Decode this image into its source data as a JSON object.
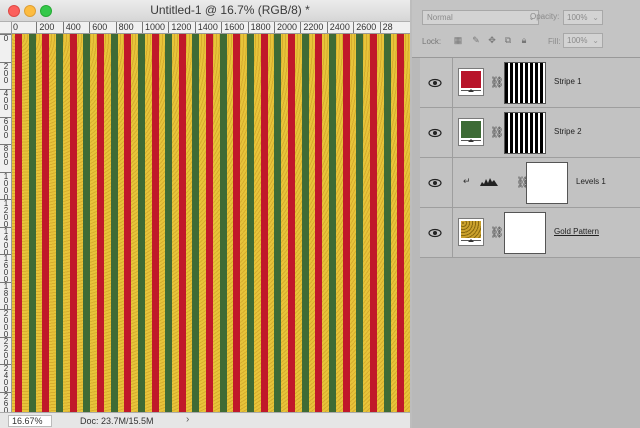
{
  "window": {
    "title": "Untitled-1 @ 16.7% (RGB/8) *"
  },
  "ruler": {
    "h_ticks": [
      "0",
      "200",
      "400",
      "600",
      "800",
      "1000",
      "1200",
      "1400",
      "1600",
      "1800",
      "2000",
      "2200",
      "2400",
      "2600",
      "28"
    ],
    "v_ticks": [
      "0",
      "2\n0\n0",
      "4\n0\n0",
      "6\n0\n0",
      "8\n0\n0",
      "1\n0\n0\n0",
      "1\n2\n0\n0",
      "1\n4\n0\n0",
      "1\n6\n0\n0",
      "1\n8\n0\n0",
      "2\n0\n0\n0",
      "2\n2\n0\n0",
      "2\n4\n0\n0",
      "2\n6\n0\n0"
    ]
  },
  "canvas": {
    "gold_color": "#e8c43a",
    "red_color": "#c0182a",
    "green_color": "#3f6b35"
  },
  "status": {
    "zoom": "16.67%",
    "doc_info": "Doc: 23.7M/15.5M",
    "arrow": "›"
  },
  "options": {
    "blend_mode": "Normal",
    "opacity_label": "Opacity:",
    "opacity_value": "100%",
    "lock_label": "Lock:",
    "fill_label": "Fill:",
    "fill_value": "100%"
  },
  "layers": [
    {
      "name": "Stripe 1",
      "swatch_color": "#b8142a",
      "mask": "stripes",
      "visible": true
    },
    {
      "name": "Stripe 2",
      "swatch_color": "#3d6b35",
      "mask": "stripes",
      "visible": true
    },
    {
      "name": "Levels 1",
      "type": "adjustment",
      "mask": "white",
      "visible": true
    },
    {
      "name": "Gold Pattern",
      "type": "pattern",
      "mask": "white",
      "visible": true
    }
  ]
}
